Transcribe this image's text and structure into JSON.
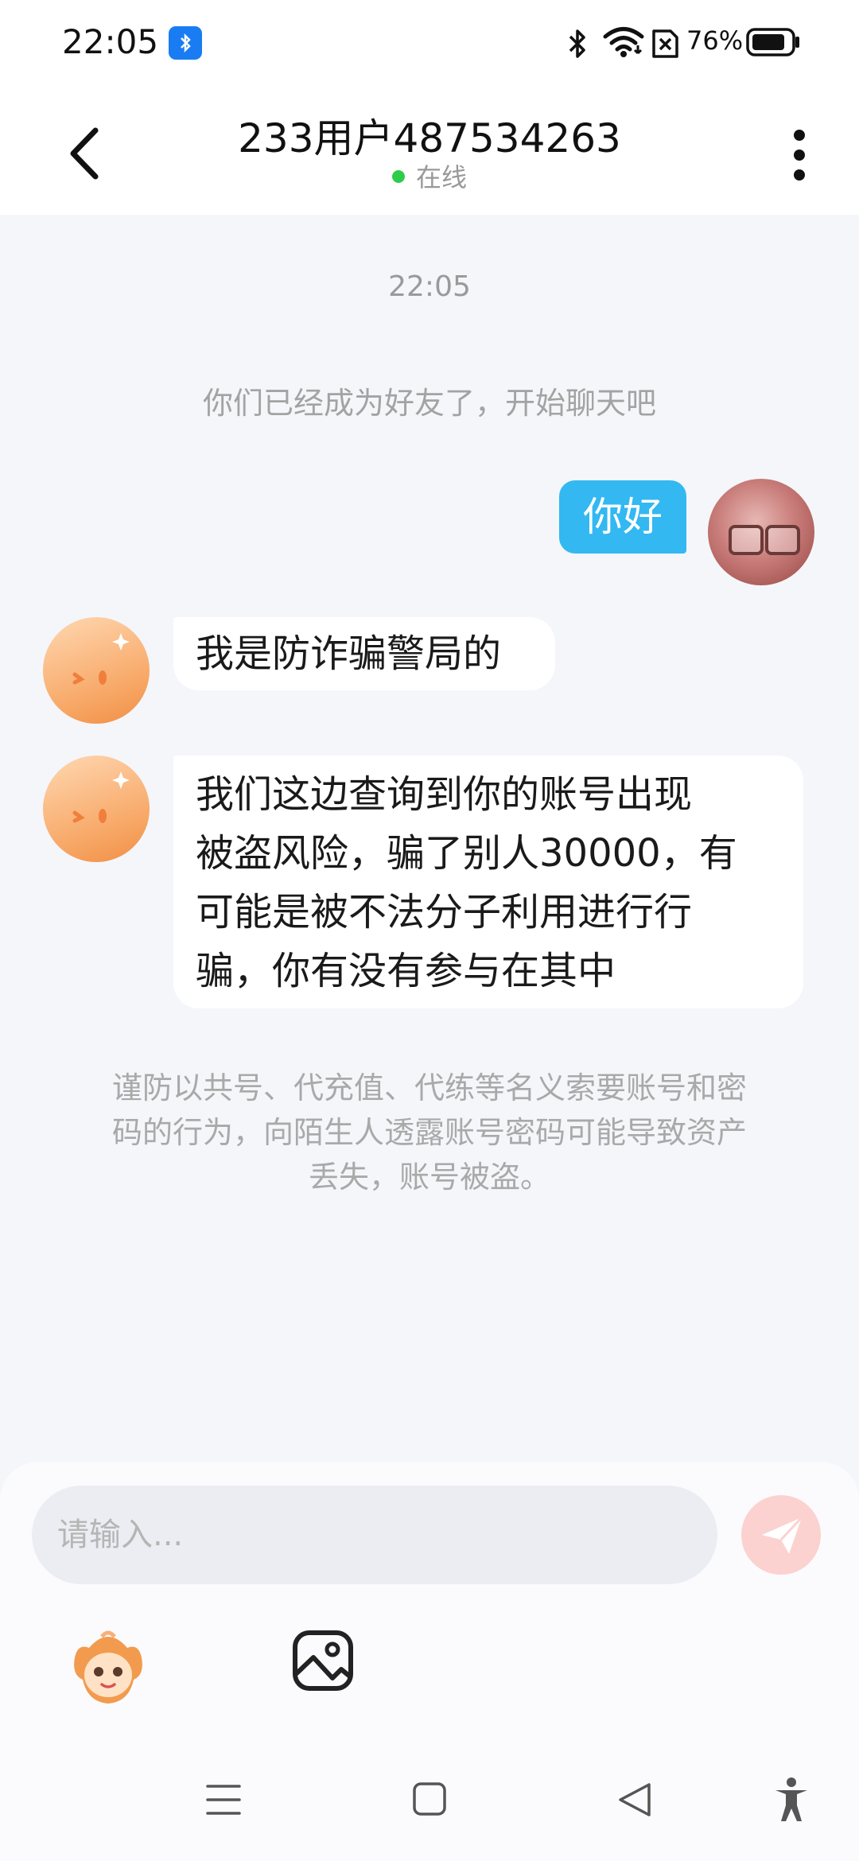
{
  "status_bar": {
    "time": "22:05",
    "battery": "76%",
    "icons": [
      "bluetooth-app-icon",
      "bluetooth-icon",
      "wifi-icon",
      "sim-off-icon",
      "battery-icon"
    ]
  },
  "header": {
    "title": "233用户487534263",
    "status": "在线",
    "status_color": "#2ecc4a"
  },
  "chat": {
    "time": "22:05",
    "system_message": "你们已经成为好友了，开始聊天吧",
    "messages": [
      {
        "from": "me",
        "text": "你好"
      },
      {
        "from": "other",
        "text": "我是防诈骗警局的"
      },
      {
        "from": "other",
        "lines": [
          "我们这边查询到你的账号出现",
          "被盗风险，骗了别人30000，有",
          "可能是被不法分子利用进行行",
          "骗，你有没有参与在其中"
        ]
      }
    ],
    "warning_lines": [
      "谨防以共号、代充值、代练等名义索要账号和密",
      "码的行为，向陌生人透露账号密码可能导致资产",
      "丢失，账号被盗。"
    ]
  },
  "input": {
    "placeholder": "请输入...",
    "accent": "#33b8f1"
  },
  "toolbar": {
    "icons": [
      "sticker-icon",
      "image-icon"
    ]
  },
  "nav": {
    "icons": [
      "menu-icon",
      "home-icon",
      "back-icon",
      "accessibility-icon"
    ]
  }
}
